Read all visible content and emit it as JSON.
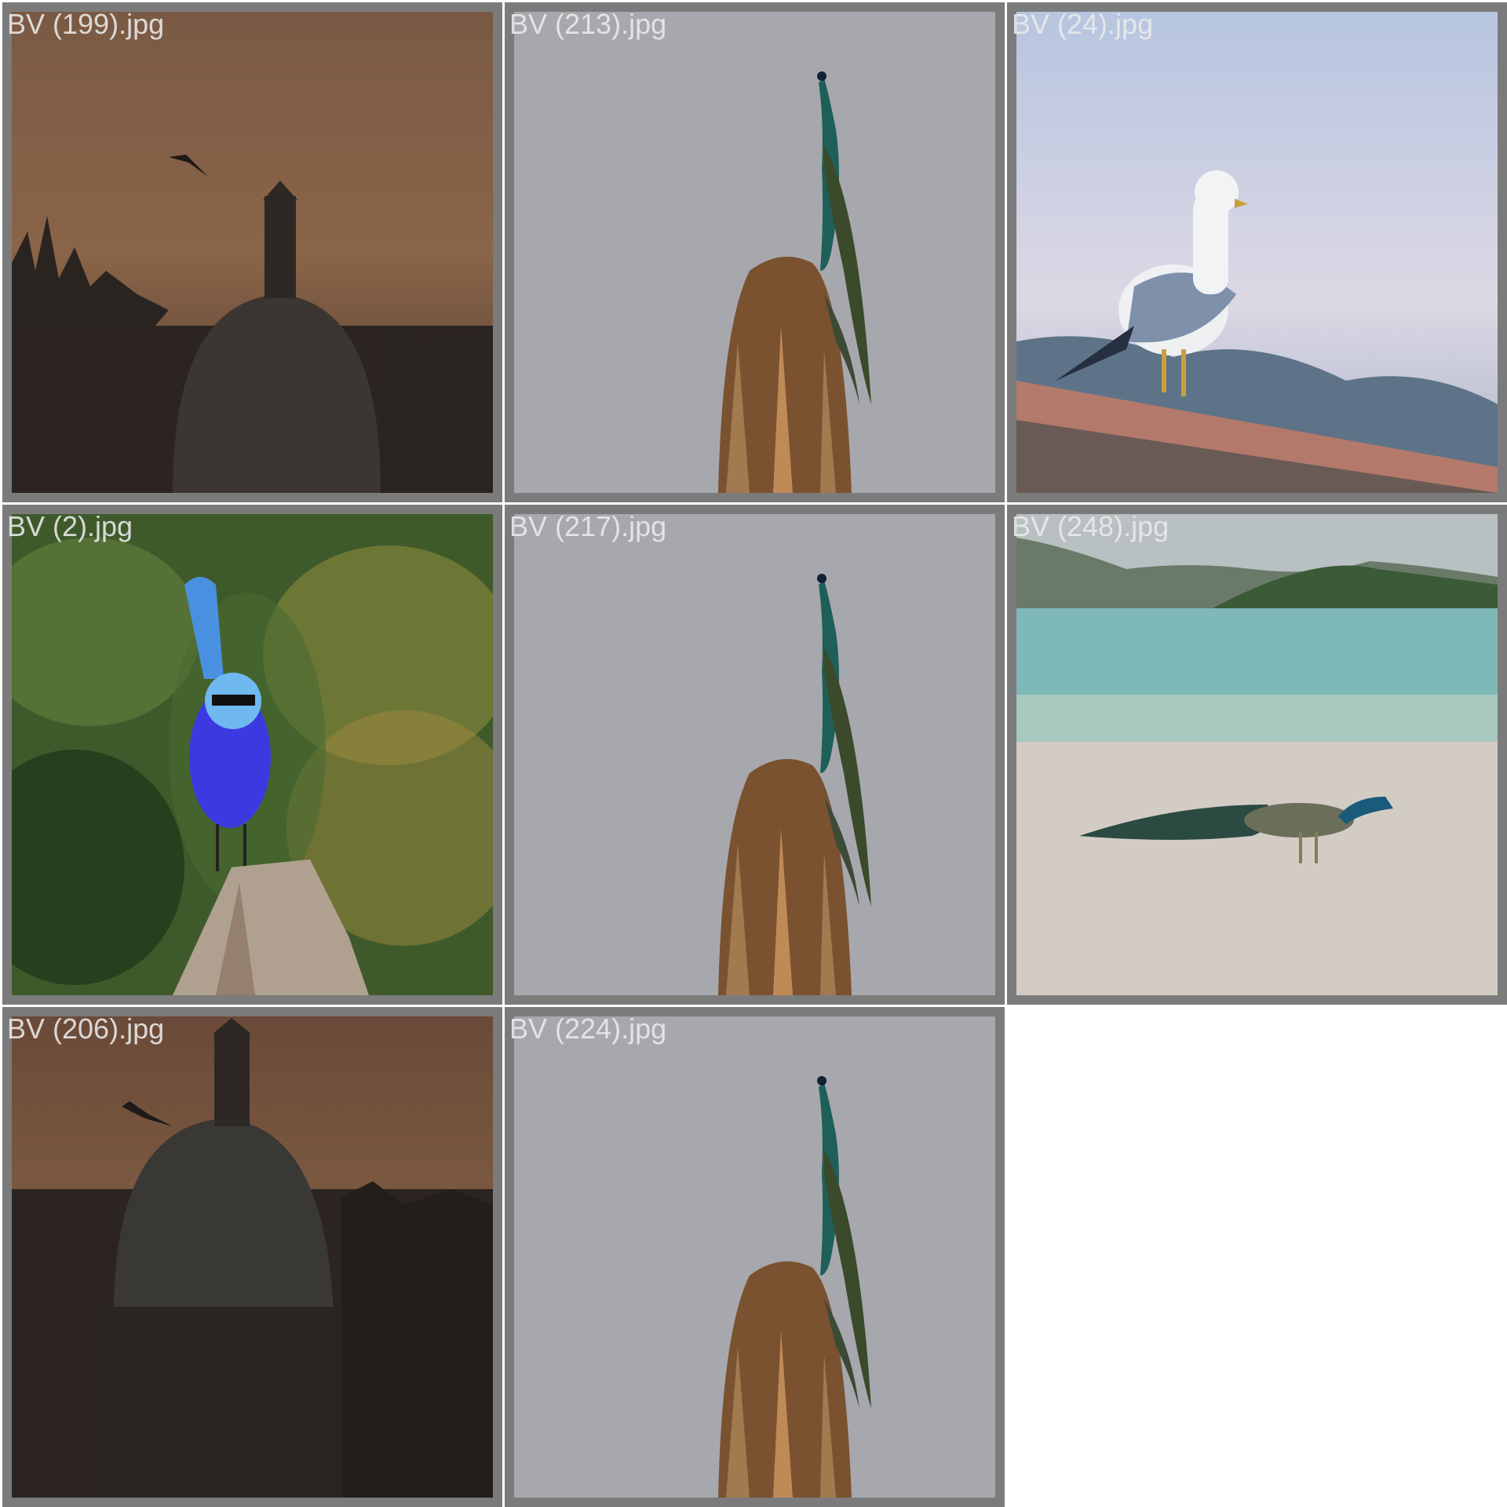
{
  "gallery": {
    "tiles": [
      {
        "filename": "BV (199).jpg",
        "subject": "dome-tower-silhouette-sunset"
      },
      {
        "filename": "BV (213).jpg",
        "subject": "peacock-on-palm-stump"
      },
      {
        "filename": "BV (24).jpg",
        "subject": "seagull-on-roof"
      },
      {
        "filename": "BV (2).jpg",
        "subject": "blue-wren-on-stump"
      },
      {
        "filename": "BV (217).jpg",
        "subject": "peacock-on-palm-stump"
      },
      {
        "filename": "BV (248).jpg",
        "subject": "peacock-on-beach"
      },
      {
        "filename": "BV (206).jpg",
        "subject": "dome-tower-silhouette-sunset"
      },
      {
        "filename": "BV (224).jpg",
        "subject": "peacock-on-palm-stump"
      }
    ]
  },
  "colors": {
    "tile_border": "#7b7b7b",
    "page_background": "#ffffff",
    "caption_text": "#ebebeb"
  }
}
